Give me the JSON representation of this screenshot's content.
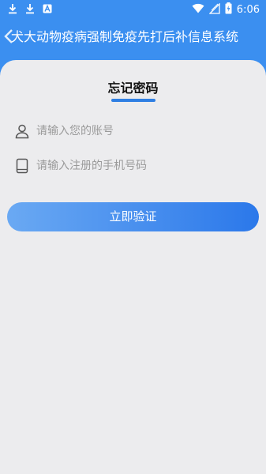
{
  "statusbar": {
    "time": "6:06",
    "icons_left": [
      "download-icon",
      "download-icon",
      "text-a-icon"
    ],
    "icons_right": [
      "wifi-icon",
      "no-signal-icon",
      "battery-charging-icon"
    ]
  },
  "appbar": {
    "title": "犬大动物疫病强制免疫先打后补信息系统",
    "back_icon": "back-icon"
  },
  "page": {
    "title": "忘记密码"
  },
  "form": {
    "account_placeholder": "请输入您的账号",
    "phone_placeholder": "请输入注册的手机号码",
    "verify_label": "立即验证"
  },
  "colors": {
    "header_bg": "#3b8ff0",
    "card_bg": "#ececee",
    "accent": "#2f7fe3",
    "button_gradient_start": "#6aa9f3",
    "button_gradient_end": "#2b78ea"
  }
}
